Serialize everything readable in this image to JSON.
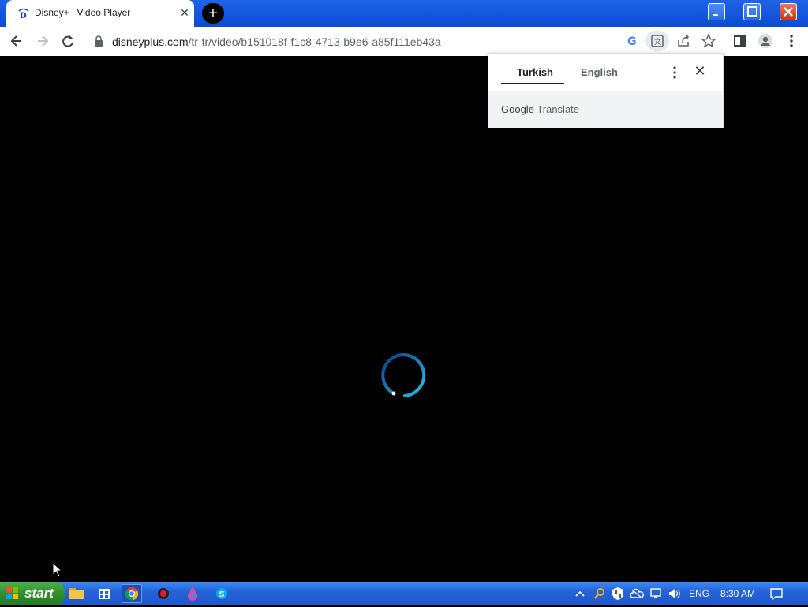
{
  "tab": {
    "title": "Disney+ | Video Player"
  },
  "toolbar": {
    "url_host": "disneyplus.com",
    "url_path": "/tr-tr/video/b151018f-f1c8-4713-b9e6-a85f111eb43a"
  },
  "translate_popup": {
    "source_language": "Turkish",
    "target_language": "English",
    "brand_google": "Google",
    "brand_translate": "Translate"
  },
  "taskbar": {
    "start_label": "start",
    "language": "ENG",
    "clock": "8:30 AM"
  },
  "colors": {
    "titlebar": "#0b4cd4",
    "taskbar": "#2563d8",
    "start": "#2f8f2f",
    "spinner": "#1aa3e0"
  }
}
